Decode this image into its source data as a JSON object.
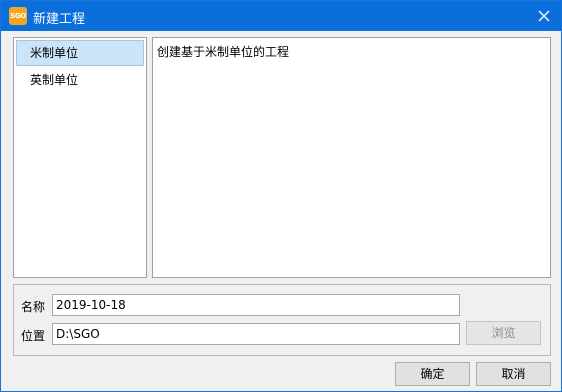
{
  "window": {
    "title": "新建工程",
    "icon_text": "SGO",
    "icon_color": "#f5a623",
    "titlebar_color": "#0a6fdc"
  },
  "unit_list": {
    "items": [
      {
        "label": "米制单位",
        "selected": true
      },
      {
        "label": "英制单位",
        "selected": false
      }
    ]
  },
  "description": "创建基于米制单位的工程",
  "form": {
    "name_label": "名称",
    "name_value": "2019-10-18",
    "location_label": "位置",
    "location_value": "D:\\SGO",
    "browse_label": "浏览"
  },
  "buttons": {
    "ok_label": "确定",
    "cancel_label": "取消"
  }
}
